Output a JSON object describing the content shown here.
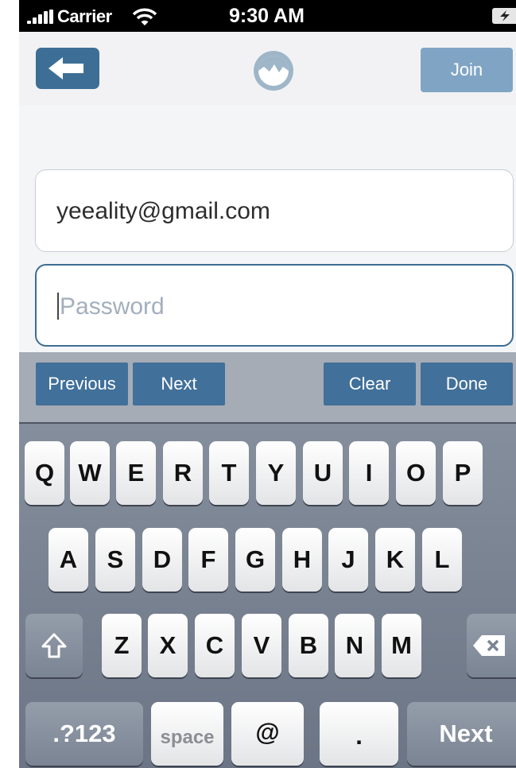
{
  "status_bar": {
    "carrier": "Carrier",
    "time": "9:30 AM"
  },
  "nav": {
    "back_icon": "back-arrow-icon",
    "logo_icon": "app-logo-icon",
    "join_label": "Join"
  },
  "form": {
    "email_value": "yeeality@gmail.com",
    "password_placeholder": "Password"
  },
  "toolbar": {
    "previous": "Previous",
    "next": "Next",
    "clear": "Clear",
    "done": "Done"
  },
  "keyboard": {
    "row1": [
      "Q",
      "W",
      "E",
      "R",
      "T",
      "Y",
      "U",
      "I",
      "O",
      "P"
    ],
    "row2": [
      "A",
      "S",
      "D",
      "F",
      "G",
      "H",
      "J",
      "K",
      "L"
    ],
    "row3": [
      "Z",
      "X",
      "C",
      "V",
      "B",
      "N",
      "M"
    ],
    "numbers_label": ".?123",
    "space_label": "space",
    "at_label": "@",
    "dot_label": ".",
    "return_label": "Next",
    "shift_icon": "shift-arrow-icon",
    "delete_icon": "backspace-icon"
  },
  "colors": {
    "accent": "#3d6f96",
    "join_bg": "#80a5c4",
    "toolbar_bg": "#a5acb6"
  }
}
